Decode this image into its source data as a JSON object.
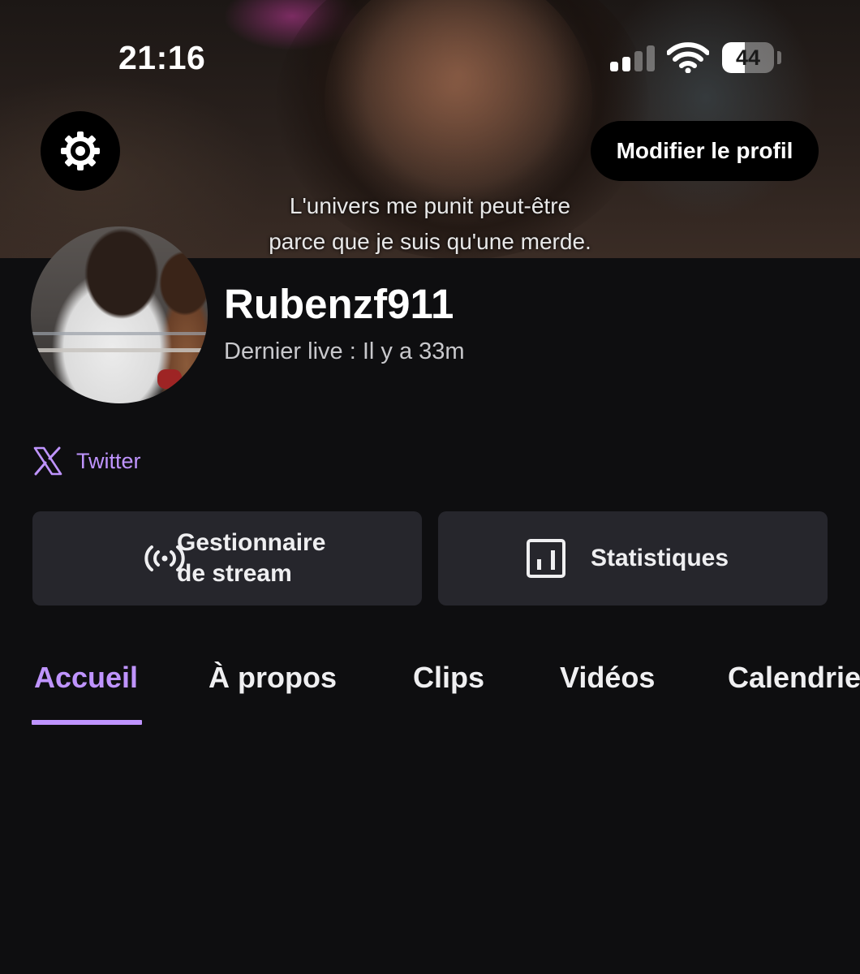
{
  "status_bar": {
    "time": "21:16",
    "battery_percent": 44,
    "signal_bars_active": 2,
    "signal_bars_total": 4
  },
  "header": {
    "settings_icon": "gear-icon",
    "edit_profile_label": "Modifier le profil",
    "banner_caption_line1": "L'univers me punit peut-être",
    "banner_caption_line2": "parce que je suis qu'une merde."
  },
  "profile": {
    "username": "Rubenzf911",
    "last_live": "Dernier live : Il y a 33m",
    "social_links": [
      {
        "icon": "x-logo-icon",
        "label": "Twitter"
      }
    ]
  },
  "actions": [
    {
      "icon": "broadcast-icon",
      "label_line1": "Gestionnaire",
      "label_line2": "de stream"
    },
    {
      "icon": "stats-chart-icon",
      "label": "Statistiques"
    }
  ],
  "tabs": [
    {
      "label": "Accueil",
      "active": true
    },
    {
      "label": "À propos",
      "active": false
    },
    {
      "label": "Clips",
      "active": false
    },
    {
      "label": "Vidéos",
      "active": false
    },
    {
      "label": "Calendrier",
      "active": false
    }
  ],
  "colors": {
    "accent": "#bf94ff",
    "background": "#0e0e10",
    "card": "#26262c"
  }
}
